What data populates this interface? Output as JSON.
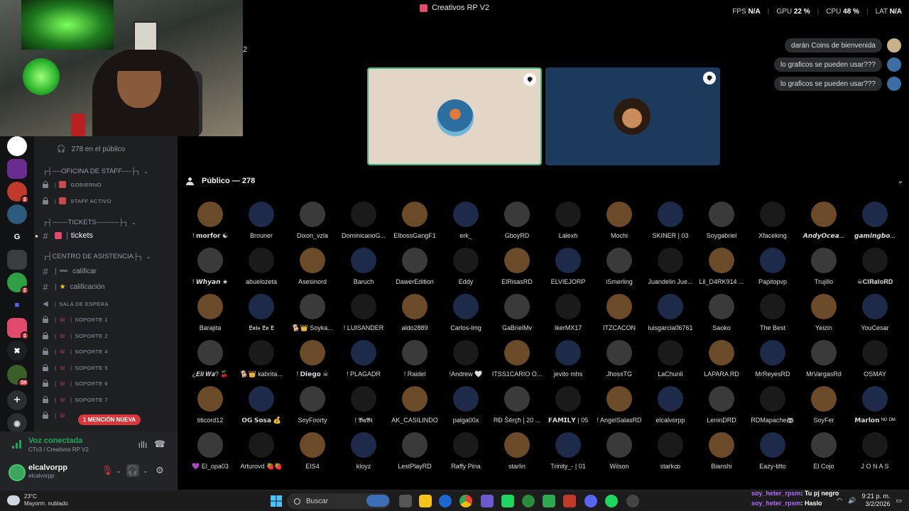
{
  "window": {
    "title": "Creativos RP V2"
  },
  "perf": {
    "fps_label": "FPS",
    "fps": "N/A",
    "gpu_label": "GPU",
    "gpu": "22 %",
    "cpu_label": "CPU",
    "cpu": "48 %",
    "lat_label": "LAT",
    "lat": "N/A"
  },
  "cam_side_text": "2",
  "sidebar": {
    "audience_count": "278 en el público",
    "categories": {
      "staff": "----OFICINA DE STAFF----",
      "tickets": "-------TICKETS----------",
      "asistencia": "CENTRO DE ASISTENCIA"
    },
    "channels": {
      "gobierno": "GOBIERNO",
      "staff_activo": "STAFF ACTIVO",
      "tickets": "tickets",
      "calificar": "calificar",
      "calificacion": "calificación",
      "sala_espera": "SALA DE ESPERA",
      "soporte1": "SOPORTE 1",
      "soporte2": "SOPORTE 2",
      "soporte4": "SOPORTE 4",
      "soporte5": "SOPORTE 5",
      "soporte6": "SOPORTE 6",
      "soporte7": "SOPORTE 7"
    },
    "mention_badge": "1 MENCIÓN NUEVA"
  },
  "rail_badges": {
    "b1": "2",
    "b2": "1",
    "b3": "2",
    "b4": "34"
  },
  "rail_letter": "G",
  "voice": {
    "status": "Voz conectada",
    "channel": "CTv3 / Creativos RP V2",
    "username": "elcalvorpp",
    "tag": "elcalvorpp"
  },
  "chat": [
    {
      "text": "darán Coins de bienvenida"
    },
    {
      "text": "lo graficos se pueden usar???"
    },
    {
      "text": "lo graficos se pueden usar???"
    }
  ],
  "audience": {
    "header": "Público — 278",
    "members": [
      "! 𝗺𝗼𝗿𝗳𝗼𝗿 ☯",
      "Brouner",
      "Dixon_vzla",
      "DominicanoG...",
      "ElbossGangF1",
      "erk_",
      "GboyRD",
      "Lalexh",
      "Mochi",
      "SKINER | 03",
      "Soygabriel",
      "Xfaceking",
      "𝘼𝙣𝙙𝙮𝙊𝙘𝙚𝙖...",
      "𝙜𝙖𝙢𝙞𝙣𝙜𝙗𝙤...",
      "! 𝙒𝙝𝙮𝙖𝙣 ★",
      "abuelozeta",
      "Asesinord",
      "Baruch",
      "DawerEdition",
      "Eddy",
      "ElRisasRD",
      "ELVIEJORP",
      "iSmerling",
      "Juandelin Jue...",
      "Lil_D4RK914 ...",
      "Papitopvp",
      "Trujillo",
      "☠𝐂𝐈𝐑𝐚𝐭𝐨𝐑𝐃",
      "Barajita",
      "𝕷𝖚𝖎𝖘 𝕷𝖔 𝕷",
      "🐕👑 Soyka...",
      "! LUISANDER",
      "aldo2889",
      "Carlos-lmg",
      "GaBrielMv",
      "IkerMX17",
      "ITZCACON",
      "luisgarcia06761",
      "Saoko",
      "The Best",
      "Yeizin",
      "YouCesar",
      "¿𝑬𝒍𝒊 𝑾𝒂? 🍒",
      "🐕👑 kabrita...",
      "! 𝗗𝗶𝗲𝗴𝗼 ☠",
      "! PLAGADR",
      "! Raidel",
      "!Andrew 🤍",
      "ITSS1CARIO O...",
      "jevito mhs",
      "JhossTG",
      "LaChunli",
      "LAPARA RD",
      "MrReyesRD",
      "MrVargasRd",
      "OSMAY",
      "titicord12",
      "𝗢𝗚 𝗦𝗼𝘀𝗮 💰",
      "SoyFoorty",
      "! 𝕭𝖚𝕭𝖎",
      "AK_CASILINDO",
      "palga00x",
      "RĐ Šěrçħ | 20 ...",
      "𝗙𝗔𝗠𝗜𝗟𝗬 | 05",
      "! AngelSalasRD",
      "elcalvorpp",
      "LeninDRD",
      "RDMapache🦝",
      "SoyFer",
      "𝗠𝗮𝗿𝗹𝗼𝗻 ᴺᴼ ᴰᴹ",
      "💜 El_opa03",
      "Arturovd 🍓🍓",
      "EIS4",
      "kloyz",
      "LestPlayRD",
      "Raffy Pina",
      "starlin",
      "Trinity_- | 01",
      "Wilson",
      "starkꝏ",
      "Bianshi",
      "Eazy-titto",
      "El Cojo",
      "J O N A S"
    ]
  },
  "taskbar": {
    "temp": "23°C",
    "weather": "Mayorm. nublado",
    "search": "Buscar",
    "time": "9:21 p. m.",
    "date": "3/2/2026"
  },
  "stream_chat": [
    {
      "name": "soy_heter_rpsm",
      "msg": "Tu pj negro"
    },
    {
      "name": "soy_heter_rpsm",
      "msg": "Haslo"
    }
  ],
  "colors": {
    "accent_green": "#23a55a",
    "mention_red": "#da373c",
    "brand_pink": "#e24b6e",
    "speaking_border": "#43b581"
  }
}
